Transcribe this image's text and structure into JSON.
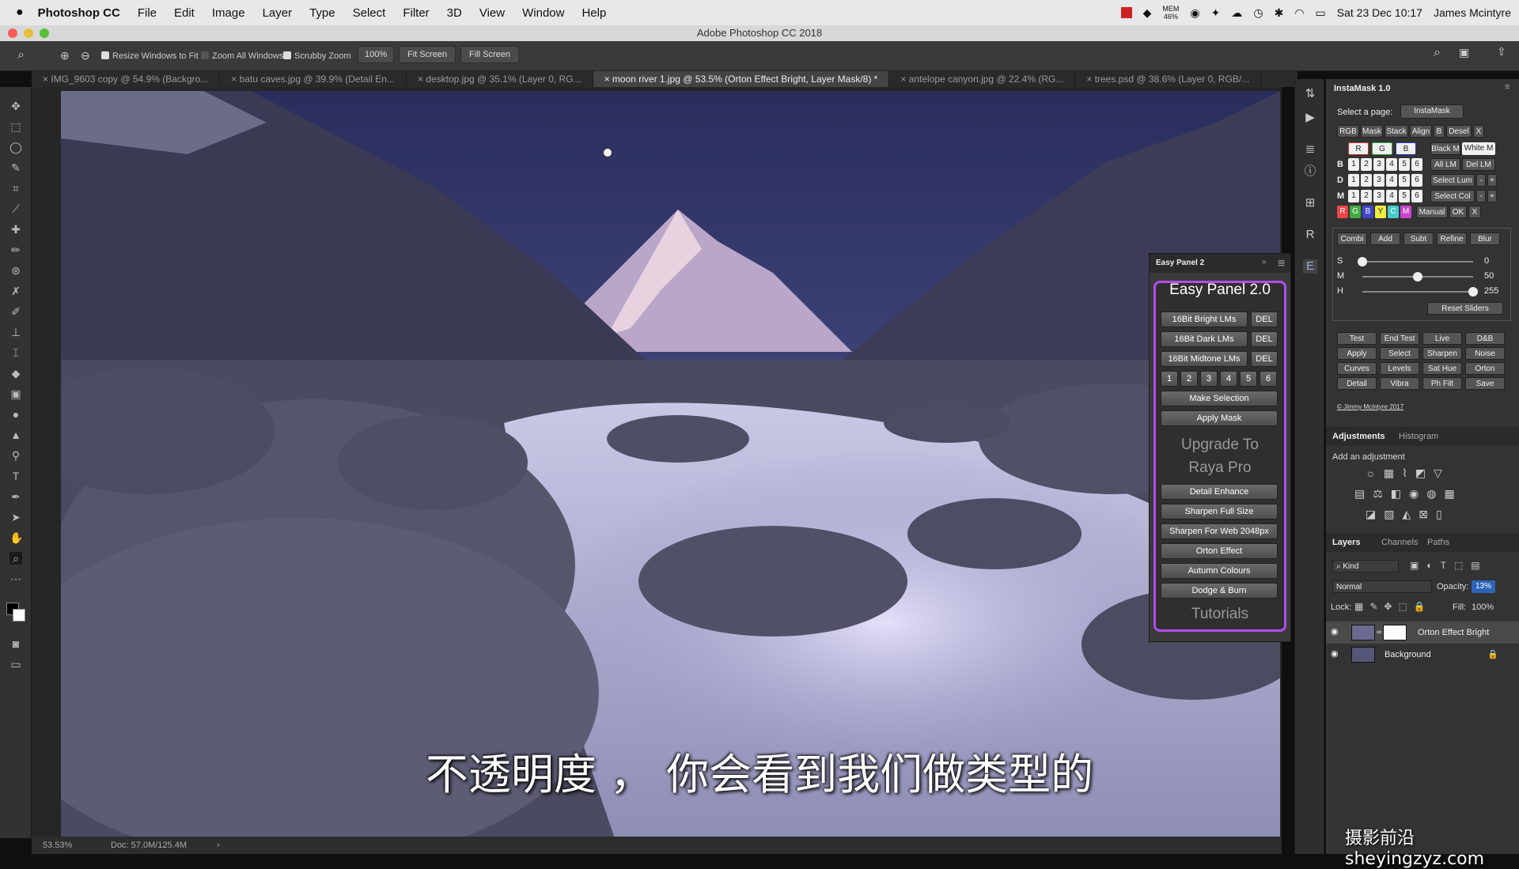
{
  "menubar": {
    "app_name": "Photoshop CC",
    "items": [
      "File",
      "Edit",
      "Image",
      "Layer",
      "Type",
      "Select",
      "Filter",
      "3D",
      "View",
      "Window",
      "Help"
    ],
    "status": {
      "mem_label": "MEM",
      "mem_value": "46%",
      "datetime": "Sat 23 Dec  10:17",
      "user": "James Mcintyre"
    }
  },
  "window": {
    "title": "Adobe Photoshop CC 2018"
  },
  "options": {
    "resize_windows_label": "Resize Windows to Fit",
    "zoom_all_windows_label": "Zoom All Windows",
    "scrubby_zoom_label": "Scrubby Zoom",
    "zoom_value": "100%",
    "fit_screen_label": "Fit Screen",
    "fill_screen_label": "Fill Screen"
  },
  "tabs": [
    {
      "label": "IMG_9603 copy @ 54.9% (Backgro..."
    },
    {
      "label": "batu caves.jpg @ 39.9% (Detail En..."
    },
    {
      "label": "desktop.jpg @ 35.1% (Layer 0, RG..."
    },
    {
      "label": "moon river 1.jpg @ 53.5% (Orton Effect Bright, Layer Mask/8) *"
    },
    {
      "label": "antelope canyon.jpg @ 22.4% (RG..."
    },
    {
      "label": "trees.psd @ 38.6% (Layer 0, RGB/..."
    }
  ],
  "status": {
    "zoom": "53.53%",
    "doc": "Doc: 57.0M/125.4M"
  },
  "instamask": {
    "title": "InstaMask 1.0",
    "select_page_label": "Select a page:",
    "select_page_value": "InstaMask",
    "row1": [
      "RGB",
      "Mask",
      "Stack",
      "Align",
      "B",
      "Desel",
      "X"
    ],
    "row2": [
      "R",
      "G",
      "B",
      "Black M",
      "White M"
    ],
    "row3_prefix": "B",
    "row3_extra": [
      "All LM",
      "Del LM"
    ],
    "row4_prefix": "D",
    "row4_extra": [
      "Select Lum",
      "-",
      "+"
    ],
    "row5_prefix": "M",
    "row5_extra": [
      "Select Col",
      "-",
      "+"
    ],
    "numbers": [
      "1",
      "2",
      "3",
      "4",
      "5",
      "6"
    ],
    "row6": [
      "R",
      "G",
      "B",
      "Y",
      "C",
      "M",
      "Manual",
      "OK",
      "X"
    ],
    "tabs2": [
      "Combi",
      "Add",
      "Subt",
      "Refine",
      "Blur"
    ],
    "sliders": [
      {
        "label": "S",
        "value": "0",
        "level": 0
      },
      {
        "label": "M",
        "value": "50",
        "level": 0.5
      },
      {
        "label": "H",
        "value": "255",
        "level": 1
      }
    ],
    "reset_label": "Reset Sliders",
    "grid": [
      "Test",
      "End Test",
      "Live",
      "D&B",
      "Apply",
      "Select",
      "Sharpen",
      "Noise",
      "Curves",
      "Levels",
      "Sat Hue",
      "Orton",
      "Detail",
      "Vibra",
      "Ph Filt",
      "Save"
    ],
    "copyright": "© Jimmy McIntyre 2017"
  },
  "adjustments": {
    "tab1": "Adjustments",
    "tab2": "Histogram",
    "add_label": "Add an adjustment"
  },
  "layers": {
    "tabs": [
      "Layers",
      "Channels",
      "Paths"
    ],
    "kind_label": "Kind",
    "blend_mode": "Normal",
    "opacity_label": "Opacity:",
    "opacity_value": "13%",
    "lock_label": "Lock:",
    "fill_label": "Fill:",
    "fill_value": "100%",
    "items": [
      {
        "name": "Orton Effect Bright"
      },
      {
        "name": "Background"
      }
    ]
  },
  "easypanel": {
    "tab_title": "Easy Panel 2",
    "heading": "Easy Panel 2.0",
    "lm_buttons": [
      "16Bit Bright LMs",
      "16Bit Dark LMs",
      "16Bit Midtone LMs"
    ],
    "del_label": "DEL",
    "numbers": [
      "1",
      "2",
      "3",
      "4",
      "5",
      "6"
    ],
    "make_selection": "Make Selection",
    "apply_mask": "Apply Mask",
    "upgrade_line1": "Upgrade To",
    "upgrade_line2": "Raya Pro",
    "actions": [
      "Detail Enhance",
      "Sharpen Full Size",
      "Sharpen For Web 2048px",
      "Orton Effect",
      "Autumn Colours",
      "Dodge & Burn"
    ],
    "tutorials": "Tutorials"
  },
  "subtitle": "不透明度 ， 你会看到我们做类型的",
  "watermark": "摄影前沿 sheyingzyz.com"
}
